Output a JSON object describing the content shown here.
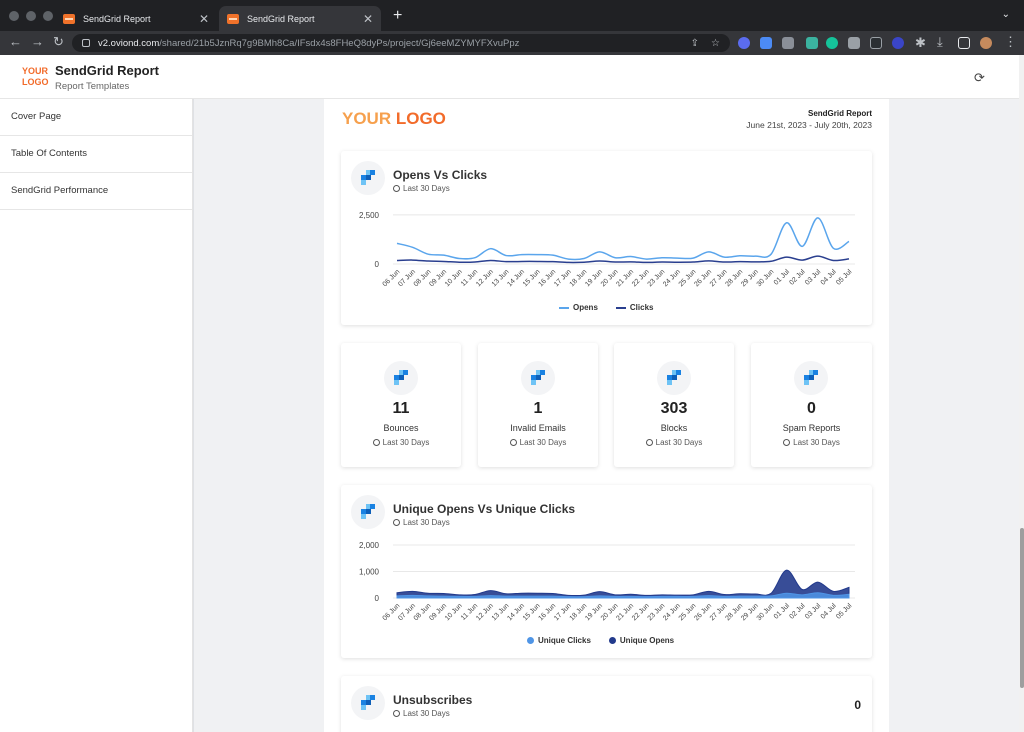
{
  "browser": {
    "tabs": [
      {
        "title": "SendGrid Report",
        "active": false
      },
      {
        "title": "SendGrid Report",
        "active": true
      }
    ],
    "url_host": "v2.oviond.com",
    "url_path": "/shared/21b5JznRq7g9BMh8Ca/IFsdx4s8FHeQ8dyPs/project/Gj6eeMZYMYFXvuPpz"
  },
  "app": {
    "logo_line1": "YOUR",
    "logo_line2": "LOGO",
    "title": "SendGrid Report",
    "subtitle": "Report Templates"
  },
  "sidebar": {
    "items": [
      {
        "label": "Cover Page"
      },
      {
        "label": "Table Of Contents"
      },
      {
        "label": "SendGrid Performance"
      }
    ]
  },
  "report": {
    "logo_part1": "YOUR ",
    "logo_part2": "LOGO",
    "header_title": "SendGrid Report",
    "header_dates": "June 21st, 2023 - July 20th, 2023"
  },
  "opens_clicks": {
    "title": "Opens Vs Clicks",
    "period": "Last 30 Days"
  },
  "stats": [
    {
      "value": "11",
      "label": "Bounces",
      "period": "Last 30 Days"
    },
    {
      "value": "1",
      "label": "Invalid Emails",
      "period": "Last 30 Days"
    },
    {
      "value": "303",
      "label": "Blocks",
      "period": "Last 30 Days"
    },
    {
      "value": "0",
      "label": "Spam Reports",
      "period": "Last 30 Days"
    }
  ],
  "unique": {
    "title": "Unique Opens Vs Unique Clicks",
    "period": "Last 30 Days"
  },
  "unsubscribes": {
    "title": "Unsubscribes",
    "period": "Last 30 Days",
    "value": "0"
  },
  "colors": {
    "opens": "#5aa5ec",
    "clicks": "#2a3f8f",
    "unique_clicks": "#4f95e6",
    "unique_opens": "#223a8c",
    "logo_orange": "#f26b2a"
  },
  "chart_data": [
    {
      "type": "line",
      "categories": [
        "06 Jun",
        "07 Jun",
        "08 Jun",
        "09 Jun",
        "10 Jun",
        "11 Jun",
        "12 Jun",
        "13 Jun",
        "14 Jun",
        "15 Jun",
        "16 Jun",
        "17 Jun",
        "18 Jun",
        "19 Jun",
        "20 Jun",
        "21 Jun",
        "22 Jun",
        "23 Jun",
        "24 Jun",
        "25 Jun",
        "26 Jun",
        "27 Jun",
        "28 Jun",
        "29 Jun",
        "30 Jun",
        "01 Jul",
        "02 Jul",
        "03 Jul",
        "04 Jul",
        "05 Jul"
      ],
      "series": [
        {
          "name": "Opens",
          "values": [
            1050,
            850,
            500,
            450,
            280,
            320,
            780,
            430,
            480,
            480,
            450,
            250,
            280,
            620,
            320,
            380,
            250,
            320,
            300,
            300,
            620,
            350,
            420,
            400,
            500,
            2100,
            900,
            2350,
            800,
            1150
          ]
        },
        {
          "name": "Clicks",
          "values": [
            180,
            200,
            150,
            130,
            90,
            100,
            180,
            120,
            130,
            130,
            120,
            80,
            90,
            150,
            100,
            110,
            80,
            100,
            90,
            100,
            160,
            100,
            120,
            110,
            140,
            350,
            200,
            400,
            180,
            260
          ]
        }
      ],
      "yticks": [
        "2,500",
        "0"
      ],
      "ylim": [
        0,
        2700
      ],
      "grid": true,
      "legend": "bottom"
    },
    {
      "type": "area",
      "categories": [
        "06 Jun",
        "07 Jun",
        "08 Jun",
        "09 Jun",
        "10 Jun",
        "11 Jun",
        "12 Jun",
        "13 Jun",
        "14 Jun",
        "15 Jun",
        "16 Jun",
        "17 Jun",
        "18 Jun",
        "19 Jun",
        "20 Jun",
        "21 Jun",
        "22 Jun",
        "23 Jun",
        "24 Jun",
        "25 Jun",
        "26 Jun",
        "27 Jun",
        "28 Jun",
        "29 Jun",
        "30 Jun",
        "01 Jul",
        "02 Jul",
        "03 Jul",
        "04 Jul",
        "05 Jul"
      ],
      "series": [
        {
          "name": "Unique Clicks",
          "values": [
            80,
            100,
            80,
            70,
            60,
            60,
            90,
            70,
            70,
            70,
            70,
            50,
            50,
            80,
            60,
            60,
            50,
            60,
            60,
            60,
            90,
            60,
            70,
            70,
            80,
            180,
            120,
            200,
            100,
            140
          ]
        },
        {
          "name": "Unique Opens",
          "values": [
            200,
            250,
            180,
            170,
            120,
            130,
            280,
            160,
            180,
            180,
            170,
            100,
            110,
            240,
            120,
            140,
            100,
            120,
            110,
            120,
            250,
            130,
            160,
            150,
            180,
            1050,
            320,
            600,
            250,
            400
          ]
        }
      ],
      "yticks": [
        "2,000",
        "1,000",
        "0"
      ],
      "ylim": [
        0,
        2000
      ],
      "grid": true,
      "legend": "bottom"
    }
  ]
}
